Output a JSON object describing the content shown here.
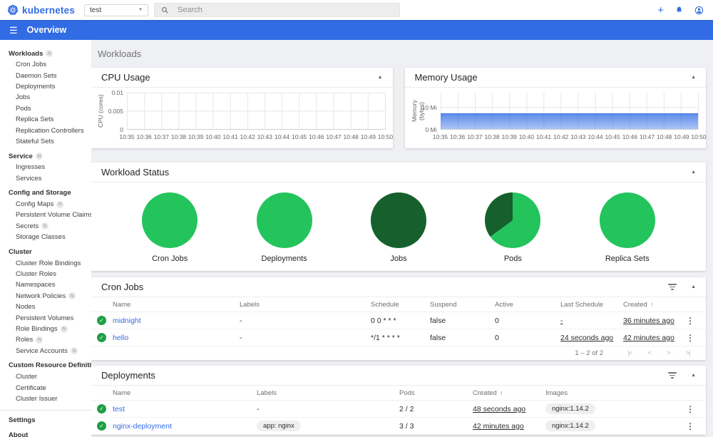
{
  "theme": {
    "brand_blue": "#326ce5",
    "background_gray": "#eff0f4",
    "running_green": "#24c45c",
    "succeeded_green": "#15602c",
    "status_ok_green": "#1f9e45"
  },
  "icons": {
    "caret_up": "▲",
    "dropdown": "▼",
    "plus": "+",
    "hamburger": "☰",
    "kebab": "⋮",
    "check": "✓",
    "sort_asc": "↑",
    "first_page": "|<",
    "prev_page": "<",
    "next_page": ">",
    "last_page": ">|"
  },
  "header": {
    "logo": {
      "text": "kubernetes"
    },
    "namespace": {
      "value": "test"
    },
    "search": {
      "placeholder": "Search"
    }
  },
  "toolbar": {
    "title": "Overview"
  },
  "sidebar": {
    "badge_text": "N",
    "items": [
      {
        "label": "Workloads",
        "style": "section",
        "badge": true,
        "link": true
      },
      {
        "label": "Cron Jobs",
        "style": "child",
        "link": true
      },
      {
        "label": "Daemon Sets",
        "style": "child",
        "link": true
      },
      {
        "label": "Deployments",
        "style": "child",
        "link": true
      },
      {
        "label": "Jobs",
        "style": "child",
        "link": true
      },
      {
        "label": "Pods",
        "style": "child",
        "link": true
      },
      {
        "label": "Replica Sets",
        "style": "child",
        "link": true
      },
      {
        "label": "Replication Controllers",
        "style": "child",
        "link": true
      },
      {
        "label": "Stateful Sets",
        "style": "child",
        "link": true
      },
      {
        "label": "Service",
        "style": "section",
        "badge": true,
        "link": true
      },
      {
        "label": "Ingresses",
        "style": "child",
        "link": true
      },
      {
        "label": "Services",
        "style": "child",
        "link": true
      },
      {
        "label": "Config and Storage",
        "style": "section",
        "link": false
      },
      {
        "label": "Config Maps",
        "style": "child",
        "badge": true,
        "link": true
      },
      {
        "label": "Persistent Volume Claims",
        "style": "child",
        "badge": true,
        "link": true
      },
      {
        "label": "Secrets",
        "style": "child",
        "badge": true,
        "link": true
      },
      {
        "label": "Storage Classes",
        "style": "child",
        "link": true
      },
      {
        "label": "Cluster",
        "style": "section",
        "link": false
      },
      {
        "label": "Cluster Role Bindings",
        "style": "child",
        "link": true
      },
      {
        "label": "Cluster Roles",
        "style": "child",
        "link": true
      },
      {
        "label": "Namespaces",
        "style": "child",
        "link": true
      },
      {
        "label": "Network Policies",
        "style": "child",
        "badge": true,
        "link": true
      },
      {
        "label": "Nodes",
        "style": "child",
        "link": true
      },
      {
        "label": "Persistent Volumes",
        "style": "child",
        "link": true
      },
      {
        "label": "Role Bindings",
        "style": "child",
        "badge": true,
        "link": true
      },
      {
        "label": "Roles",
        "style": "child",
        "badge": true,
        "link": true
      },
      {
        "label": "Service Accounts",
        "style": "child",
        "badge": true,
        "link": true
      },
      {
        "label": "Custom Resource Definitions",
        "style": "section",
        "link": false
      },
      {
        "label": "Cluster",
        "style": "child",
        "link": true
      },
      {
        "label": "Certificate",
        "style": "child",
        "link": true
      },
      {
        "label": "Cluster Issuer",
        "style": "child",
        "link": true
      },
      {
        "style": "divider"
      },
      {
        "label": "Settings",
        "style": "section",
        "link": true
      },
      {
        "label": "About",
        "style": "section",
        "link": true
      }
    ]
  },
  "page": {
    "title": "Workloads"
  },
  "panels": {
    "cpu_usage": {
      "title": "CPU Usage",
      "chart": {
        "type": "line",
        "ylabel": "CPU (cores)",
        "ylim": [
          0,
          0.01
        ],
        "yticks": [
          {
            "label": "0.01",
            "pos": 0
          },
          {
            "label": "0.005",
            "pos": 50
          },
          {
            "label": "0",
            "pos": 100
          }
        ],
        "xticks": [
          "10:35",
          "10:36",
          "10:37",
          "10:38",
          "10:39",
          "10:40",
          "10:41",
          "10:42",
          "10:43",
          "10:44",
          "10:45",
          "10:46",
          "10:47",
          "10:48",
          "10:49",
          "10:50"
        ],
        "series": []
      }
    },
    "memory_usage": {
      "title": "Memory Usage",
      "chart": {
        "type": "area",
        "ylabel": "Memory (bytes)",
        "ylim_mi": [
          0,
          16.7
        ],
        "yticks": [
          {
            "label": "10 Mi",
            "pos": 40
          },
          {
            "label": "0 Mi",
            "pos": 100
          }
        ],
        "xticks": [
          "10:35",
          "10:36",
          "10:37",
          "10:38",
          "10:39",
          "10:40",
          "10:41",
          "10:42",
          "10:43",
          "10:44",
          "10:45",
          "10:46",
          "10:47",
          "10:48",
          "10:49",
          "10:50"
        ],
        "series": [
          {
            "name": "Memory usage",
            "value_mi": 7.3,
            "area_height_pct": 44
          }
        ]
      }
    },
    "workload_status": {
      "title": "Workload Status",
      "colors": {
        "running": "#24c45c",
        "succeeded": "#15602c"
      },
      "pies": [
        {
          "label": "Cron Jobs",
          "segments": [
            {
              "status": "running",
              "percent": 100
            }
          ]
        },
        {
          "label": "Deployments",
          "segments": [
            {
              "status": "running",
              "percent": 100
            }
          ]
        },
        {
          "label": "Jobs",
          "segments": [
            {
              "status": "succeeded",
              "percent": 100
            }
          ]
        },
        {
          "label": "Pods",
          "segments": [
            {
              "status": "running",
              "percent": 65
            },
            {
              "status": "succeeded",
              "percent": 35
            }
          ]
        },
        {
          "label": "Replica Sets",
          "segments": [
            {
              "status": "running",
              "percent": 100
            }
          ]
        }
      ]
    },
    "cron_jobs": {
      "title": "Cron Jobs",
      "columns": [
        "Name",
        "Labels",
        "Schedule",
        "Suspend",
        "Active",
        "Last Schedule",
        "Created"
      ],
      "sorted_by": "Created",
      "rows": [
        {
          "status": "ok",
          "name": "midnight",
          "labels": "-",
          "schedule": "0 0 * * *",
          "suspend": "false",
          "active": "0",
          "last_schedule": "-",
          "created": "36 minutes ago"
        },
        {
          "status": "ok",
          "name": "hello",
          "labels": "-",
          "schedule": "*/1 * * * *",
          "suspend": "false",
          "active": "0",
          "last_schedule": "24 seconds ago",
          "created": "42 minutes ago"
        }
      ],
      "pagination": {
        "range": "1 – 2 of 2"
      }
    },
    "deployments": {
      "title": "Deployments",
      "columns": [
        "Name",
        "Labels",
        "Pods",
        "Created",
        "Images"
      ],
      "sorted_by": "Created",
      "rows": [
        {
          "status": "ok",
          "name": "test",
          "labels": "-",
          "labels_chip": false,
          "pods": "2 / 2",
          "created": "48 seconds ago",
          "images": "nginx:1.14.2"
        },
        {
          "status": "ok",
          "name": "nginx-deployment",
          "labels": "app: nginx",
          "labels_chip": true,
          "pods": "3 / 3",
          "created": "42 minutes ago",
          "images": "nginx:1.14.2"
        }
      ]
    }
  }
}
